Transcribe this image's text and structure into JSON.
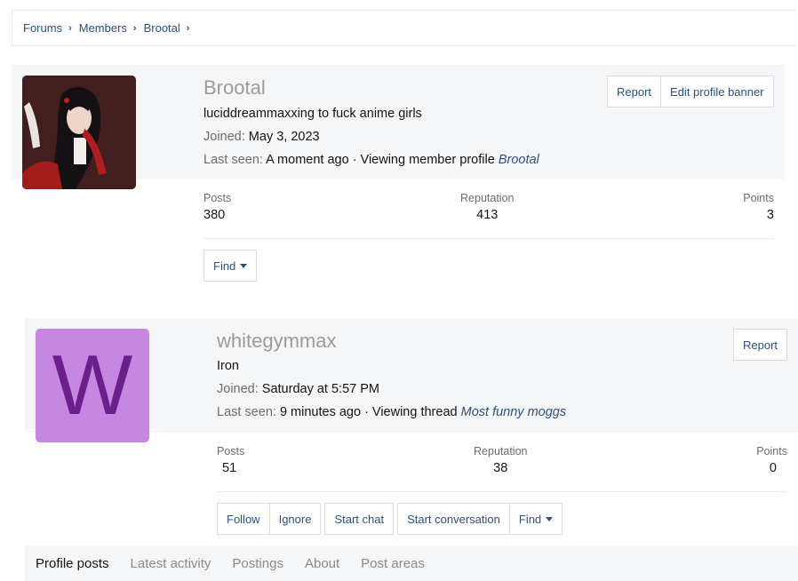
{
  "breadcrumb": [
    {
      "label": "Forums"
    },
    {
      "label": "Members"
    },
    {
      "label": "Brootal"
    }
  ],
  "profiles": [
    {
      "username": "Brootal",
      "title": "luciddreammaxxing to fuck anime girls",
      "joined_label": "Joined:",
      "joined_value": "May 3, 2023",
      "lastseen_label": "Last seen:",
      "lastseen_value": "A moment ago · Viewing member profile",
      "lastseen_link": "Brootal",
      "buttons": [
        "Report",
        "Edit profile banner"
      ],
      "stats": {
        "posts_label": "Posts",
        "posts_value": "380",
        "rep_label": "Reputation",
        "rep_value": "413",
        "points_label": "Points",
        "points_value": "3"
      },
      "actions": [
        "Find"
      ]
    },
    {
      "username": "whitegymmax",
      "avatar_letter": "W",
      "title": "Iron",
      "joined_label": "Joined:",
      "joined_value": "Saturday at 5:57 PM",
      "lastseen_label": "Last seen:",
      "lastseen_value": "9 minutes ago · Viewing thread",
      "lastseen_link": "Most funny moggs",
      "buttons": [
        "Report"
      ],
      "stats": {
        "posts_label": "Posts",
        "posts_value": "51",
        "rep_label": "Reputation",
        "rep_value": "38",
        "points_label": "Points",
        "points_value": "0"
      },
      "actions": [
        "Follow",
        "Ignore",
        "Start chat",
        "Start conversation",
        "Find"
      ]
    }
  ],
  "tabs": [
    "Profile posts",
    "Latest activity",
    "Postings",
    "About",
    "Post areas"
  ],
  "colors": {
    "link": "#2d4f7f",
    "header_bg": "#f5f6f8",
    "letter_avatar_bg": "#c588e0",
    "letter_avatar_fg": "#6a1f8c"
  },
  "icons": {
    "breadcrumb_separator": "chevron-right-icon",
    "dropdown": "caret-down-icon"
  }
}
